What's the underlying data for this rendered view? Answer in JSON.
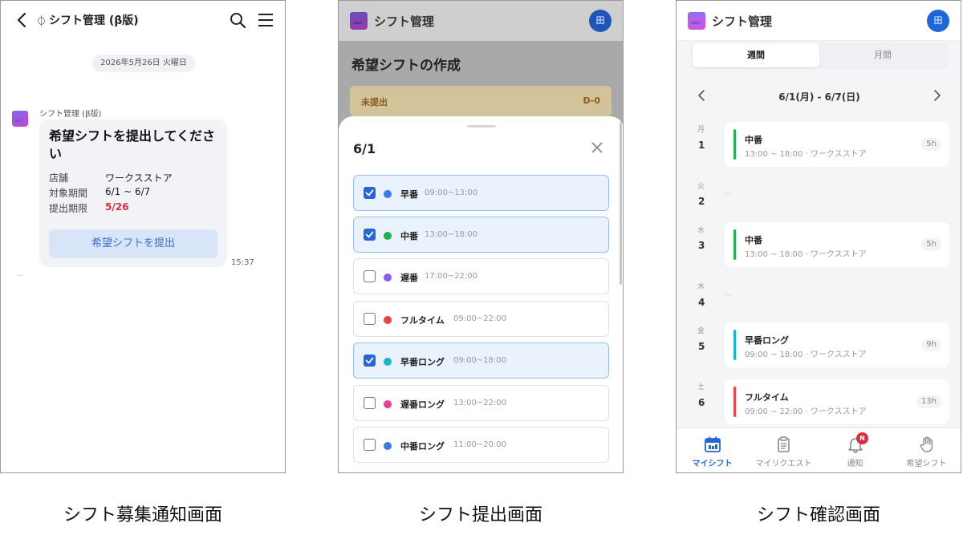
{
  "screens": {
    "notification": {
      "title": "シフト管理 (β版)",
      "date_pill": "2026年5月26日 火曜日",
      "sender": "シフト管理 (β版)",
      "message_title": "希望シフトを提出してください",
      "rows": [
        {
          "label": "店舗",
          "value": "ワークスストア"
        },
        {
          "label": "対象期間",
          "value": "6/1 ~ 6/7"
        },
        {
          "label": "提出期限",
          "value": "5/26"
        }
      ],
      "submit_label": "希望シフトを提出",
      "time": "15:37",
      "caption": "シフト募集通知画面"
    },
    "submission": {
      "app_title": "シフト管理",
      "avatar": "田",
      "page_title": "希望シフトの作成",
      "status_label": "未提出",
      "status_deadline": "D-0",
      "sheet_date": "6/1",
      "options": [
        {
          "name": "早番",
          "time": "09:00~13:00",
          "checked": true,
          "color": "#3b7be8"
        },
        {
          "name": "中番",
          "time": "13:00~18:00",
          "checked": true,
          "color": "#22b14c"
        },
        {
          "name": "遅番",
          "time": "17:00~22:00",
          "checked": false,
          "color": "#8b5cf6"
        },
        {
          "name": "フルタイム",
          "time": "09:00~22:00",
          "checked": false,
          "color": "#e84545"
        },
        {
          "name": "早番ロング",
          "time": "09:00~18:00",
          "checked": true,
          "color": "#19b5c8"
        },
        {
          "name": "遅番ロング",
          "time": "13:00~22:00",
          "checked": false,
          "color": "#e8408f"
        },
        {
          "name": "中番ロング",
          "time": "11:00~20:00",
          "checked": false,
          "color": "#3b7be8"
        }
      ],
      "caption": "シフト提出画面"
    },
    "confirm": {
      "app_title": "シフト管理",
      "avatar": "田",
      "tabs": [
        "週間",
        "月間"
      ],
      "range": "6/1(月) - 6/7(日)",
      "days": [
        {
          "dow": "月",
          "num": "1",
          "shift": {
            "name": "中番",
            "detail": "13:00 ~ 18:00 · ワークスストア",
            "hours": "5h",
            "color": "#22b14c"
          }
        },
        {
          "dow": "火",
          "num": "2",
          "shift": null
        },
        {
          "dow": "水",
          "num": "3",
          "shift": {
            "name": "中番",
            "detail": "13:00 ~ 18:00 · ワークスストア",
            "hours": "5h",
            "color": "#22b14c"
          }
        },
        {
          "dow": "木",
          "num": "4",
          "shift": null
        },
        {
          "dow": "金",
          "num": "5",
          "shift": {
            "name": "早番ロング",
            "detail": "09:00 ~ 18:00 · ワークスストア",
            "hours": "9h",
            "color": "#19b5c8"
          }
        },
        {
          "dow": "土",
          "num": "6",
          "shift": {
            "name": "フルタイム",
            "detail": "09:00 ~ 22:00 · ワークスストア",
            "hours": "13h",
            "color": "#e84545"
          }
        }
      ],
      "nav": [
        {
          "label": "マイシフト",
          "icon": "calendar-icon",
          "active": true
        },
        {
          "label": "マイリクエスト",
          "icon": "clipboard-icon",
          "active": false
        },
        {
          "label": "通知",
          "icon": "bell-icon",
          "active": false,
          "badge": "N"
        },
        {
          "label": "希望シフト",
          "icon": "hand-icon",
          "active": false
        }
      ],
      "caption": "シフト確認画面"
    }
  }
}
